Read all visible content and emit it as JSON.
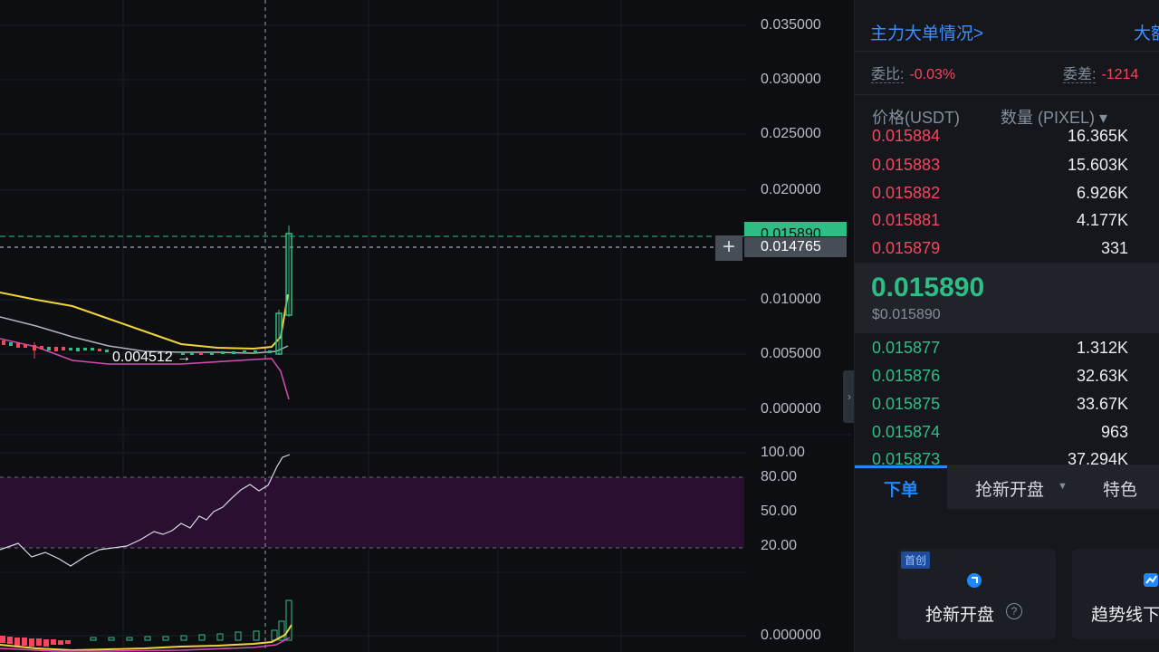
{
  "chart": {
    "price_axis": [
      "0.035000",
      "0.030000",
      "0.025000",
      "0.020000",
      "0.010000",
      "0.005000",
      "0.000000"
    ],
    "last_price_tag": "0.015890",
    "crosshair_price": "0.014765",
    "last_price_label": "0.004512 →",
    "rsi_axis": [
      "100.00",
      "80.00",
      "50.00",
      "20.00"
    ],
    "macd_axis": [
      "0.000000"
    ],
    "colors": {
      "up": "#2ebd85",
      "down": "#f6465d",
      "ma_yellow": "#f0d43a",
      "ma_white": "#b0b4bb",
      "ma_pink": "#d64bb2",
      "rsi_band": "#2b0f33",
      "rsi_line": "#d5d9de"
    }
  },
  "panel": {
    "big_order_link": "主力大单情况>",
    "big_order_right": "大额",
    "ratio_label": "委比:",
    "ratio_value": "-0.03%",
    "diff_label": "委差:",
    "diff_value": "-1214",
    "col_price": "价格(USDT)",
    "col_qty": "数量 (PIXEL) ▾",
    "asks": [
      {
        "price": "0.015884",
        "qty": "16.365K"
      },
      {
        "price": "0.015883",
        "qty": "15.603K"
      },
      {
        "price": "0.015882",
        "qty": "6.926K"
      },
      {
        "price": "0.015881",
        "qty": "4.177K"
      },
      {
        "price": "0.015879",
        "qty": "331"
      }
    ],
    "mid_price": "0.015890",
    "mid_usd": "$0.015890",
    "bids": [
      {
        "price": "0.015877",
        "qty": "1.312K"
      },
      {
        "price": "0.015876",
        "qty": "32.63K"
      },
      {
        "price": "0.015875",
        "qty": "33.67K"
      },
      {
        "price": "0.015874",
        "qty": "963"
      },
      {
        "price": "0.015873",
        "qty": "37.294K"
      }
    ],
    "tabs": [
      "下单",
      "抢新开盘",
      "特色"
    ],
    "card_badge": "首创",
    "card_1_label": "抢新开盘",
    "card_2_label": "趋势线下"
  }
}
